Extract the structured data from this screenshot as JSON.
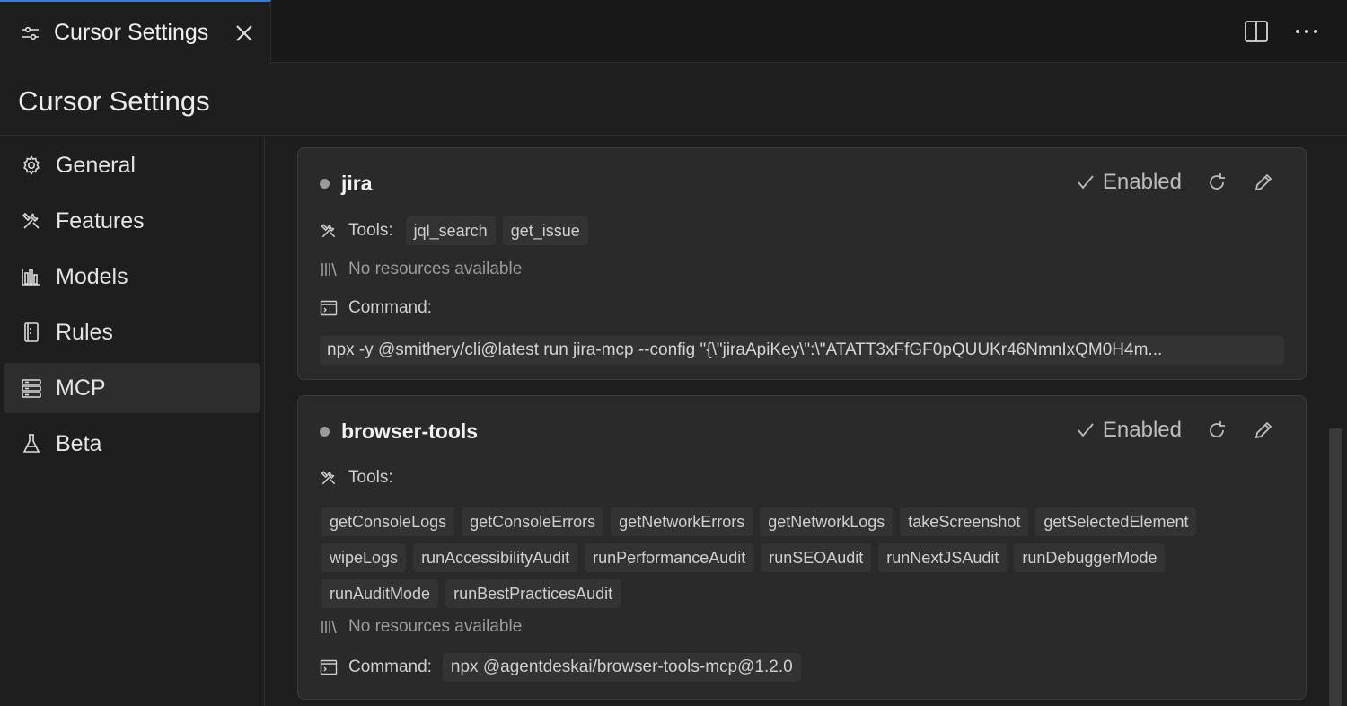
{
  "tab": {
    "title": "Cursor Settings"
  },
  "header": {
    "title": "Cursor Settings"
  },
  "sidebar": {
    "items": [
      {
        "label": "General",
        "icon": "gear-icon"
      },
      {
        "label": "Features",
        "icon": "tools-icon"
      },
      {
        "label": "Models",
        "icon": "bar-chart-icon"
      },
      {
        "label": "Rules",
        "icon": "book-icon"
      },
      {
        "label": "MCP",
        "icon": "server-icon",
        "active": true
      },
      {
        "label": "Beta",
        "icon": "flask-icon"
      }
    ]
  },
  "servers": [
    {
      "name": "jira",
      "status": "Enabled",
      "tools_label": "Tools:",
      "tools": [
        "jql_search",
        "get_issue"
      ],
      "resources": "No resources available",
      "command_label": "Command:",
      "command": "npx -y @smithery/cli@latest run jira-mcp --config \"{\\\"jiraApiKey\\\":\\\"ATATT3xFfGF0pQUUKr46NmnIxQM0H4m..."
    },
    {
      "name": "browser-tools",
      "status": "Enabled",
      "tools_label": "Tools:",
      "tools": [
        "getConsoleLogs",
        "getConsoleErrors",
        "getNetworkErrors",
        "getNetworkLogs",
        "takeScreenshot",
        "getSelectedElement",
        "wipeLogs",
        "runAccessibilityAudit",
        "runPerformanceAudit",
        "runSEOAudit",
        "runNextJSAudit",
        "runDebuggerMode",
        "runAuditMode",
        "runBestPracticesAudit"
      ],
      "resources": "No resources available",
      "command_label": "Command:",
      "command": "npx @agentdeskai/browser-tools-mcp@1.2.0"
    }
  ],
  "colors": {
    "accent": "#3b7bd6",
    "background": "#1e1e1e",
    "card": "#2a2a2a",
    "chip": "#333333"
  }
}
